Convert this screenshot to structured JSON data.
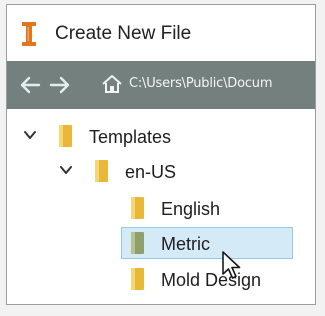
{
  "window": {
    "title": "Create New File",
    "app_icon": "autodesk-inventor-icon"
  },
  "pathbar": {
    "back_icon": "back-arrow-icon",
    "forward_icon": "forward-arrow-icon",
    "home_icon": "home-icon",
    "path": "C:\\Users\\Public\\Docum"
  },
  "tree": {
    "items": [
      {
        "label": "Templates",
        "expanded": true,
        "icon": "folder-icon"
      },
      {
        "label": "en-US",
        "expanded": true,
        "icon": "folder-icon"
      },
      {
        "label": "English",
        "icon": "folder-icon"
      },
      {
        "label": "Metric",
        "icon": "folder-icon",
        "selected": true
      },
      {
        "label": "Mold Design",
        "icon": "folder-icon"
      }
    ]
  },
  "colors": {
    "pathbar_bg": "#74807e",
    "folder_yellow": "#e9b83a",
    "selection_bg": "#d5eaf7",
    "selection_border": "#98c8e8",
    "app_icon_orange": "#e0761f"
  }
}
